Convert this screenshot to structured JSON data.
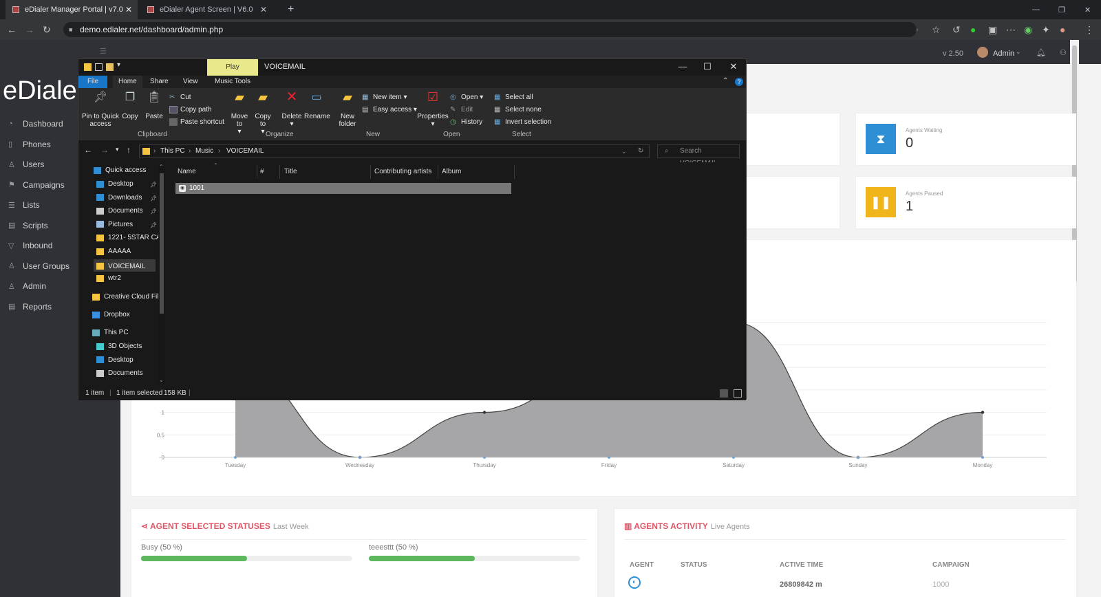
{
  "browser": {
    "tabs": [
      {
        "title": "eDialer Manager Portal | v7.0",
        "active": true
      },
      {
        "title": "eDialer Agent Screen | V6.0",
        "active": false
      }
    ],
    "url": "demo.edialer.net/dashboard/admin.php"
  },
  "app": {
    "logo": "eDialer",
    "version": "v 2.50",
    "user": "Admin",
    "nav": [
      {
        "label": "Dashboard",
        "icon": "dashboard-icon"
      },
      {
        "label": "Phones",
        "icon": "phone-icon"
      },
      {
        "label": "Users",
        "icon": "user-icon"
      },
      {
        "label": "Campaigns",
        "icon": "campaign-icon"
      },
      {
        "label": "Lists",
        "icon": "list-icon"
      },
      {
        "label": "Scripts",
        "icon": "script-icon"
      },
      {
        "label": "Inbound",
        "icon": "inbound-icon"
      },
      {
        "label": "User Groups",
        "icon": "user-groups-icon"
      },
      {
        "label": "Admin",
        "icon": "admin-icon"
      },
      {
        "label": "Reports",
        "icon": "reports-icon"
      }
    ],
    "stats": {
      "agents_waiting": {
        "label": "Agents Waiting",
        "value": "0",
        "color": "#2f8fd5"
      },
      "agents_paused": {
        "label": "Agents Paused",
        "value": "1",
        "color": "#f0b51a"
      }
    },
    "statuses": {
      "title": "AGENT SELECTED STATUSES",
      "subtitle": "Last Week",
      "items": [
        {
          "label": "Busy (50 %)",
          "percent": 50
        },
        {
          "label": "teeesttt (50 %)",
          "percent": 50
        }
      ]
    },
    "activity": {
      "title": "AGENTS ACTIVITY",
      "subtitle": "Live Agents",
      "columns": [
        "AGENT",
        "STATUS",
        "ACTIVE TIME",
        "CAMPAIGN"
      ],
      "rows": [
        {
          "status": "",
          "active_time": "26809842 m",
          "campaign": "1000"
        }
      ]
    }
  },
  "chart_data": {
    "type": "area",
    "categories": [
      "Tuesday",
      "Wednesday",
      "Thursday",
      "Friday",
      "Saturday",
      "Sunday",
      "Monday"
    ],
    "y_ticks": [
      "0",
      "0.5",
      "1"
    ],
    "series": [
      {
        "values": [
          2,
          0,
          1,
          2,
          3,
          0,
          1
        ]
      }
    ],
    "ylim": [
      0,
      3.2
    ],
    "grid": true
  },
  "explorer": {
    "title": "VOICEMAIL",
    "context_tab": "Play",
    "ribbon_tabs": [
      "File",
      "Home",
      "Share",
      "View",
      "Music Tools"
    ],
    "clipboard": {
      "pin": "Pin to Quick access",
      "copy": "Copy",
      "paste": "Paste",
      "cut": "Cut",
      "copy_path": "Copy path",
      "paste_shortcut": "Paste shortcut",
      "group": "Clipboard"
    },
    "organize": {
      "move_to": "Move to",
      "copy_to": "Copy to",
      "delete": "Delete",
      "rename": "Rename",
      "group": "Organize"
    },
    "new": {
      "new_folder": "New folder",
      "new_item": "New item",
      "easy_access": "Easy access",
      "group": "New"
    },
    "open": {
      "properties": "Properties",
      "open": "Open",
      "edit": "Edit",
      "history": "History",
      "group": "Open"
    },
    "select": {
      "select_all": "Select all",
      "select_none": "Select none",
      "invert": "Invert selection",
      "group": "Select"
    },
    "path": [
      "This PC",
      "Music",
      "VOICEMAIL"
    ],
    "search_placeholder": "Search VOICEMAIL",
    "quick_access": "Quick access",
    "nav_items": [
      {
        "label": "Desktop",
        "pinned": true
      },
      {
        "label": "Downloads",
        "pinned": true
      },
      {
        "label": "Documents",
        "pinned": true
      },
      {
        "label": "Pictures",
        "pinned": true
      },
      {
        "label": "1221- 5STAR CAL",
        "pinned": false
      },
      {
        "label": "AAAAA",
        "pinned": false
      },
      {
        "label": "VOICEMAIL",
        "pinned": false
      },
      {
        "label": "wtr2",
        "pinned": false
      }
    ],
    "creative_cloud": "Creative Cloud Fil",
    "dropbox": "Dropbox",
    "this_pc": "This PC",
    "this_pc_items": [
      "3D Objects",
      "Desktop",
      "Documents"
    ],
    "columns": [
      "Name",
      "#",
      "Title",
      "Contributing artists",
      "Album"
    ],
    "files": [
      {
        "name": "1001"
      }
    ],
    "status": {
      "count": "1 item",
      "selected": "1 item selected",
      "size": "158 KB"
    }
  }
}
